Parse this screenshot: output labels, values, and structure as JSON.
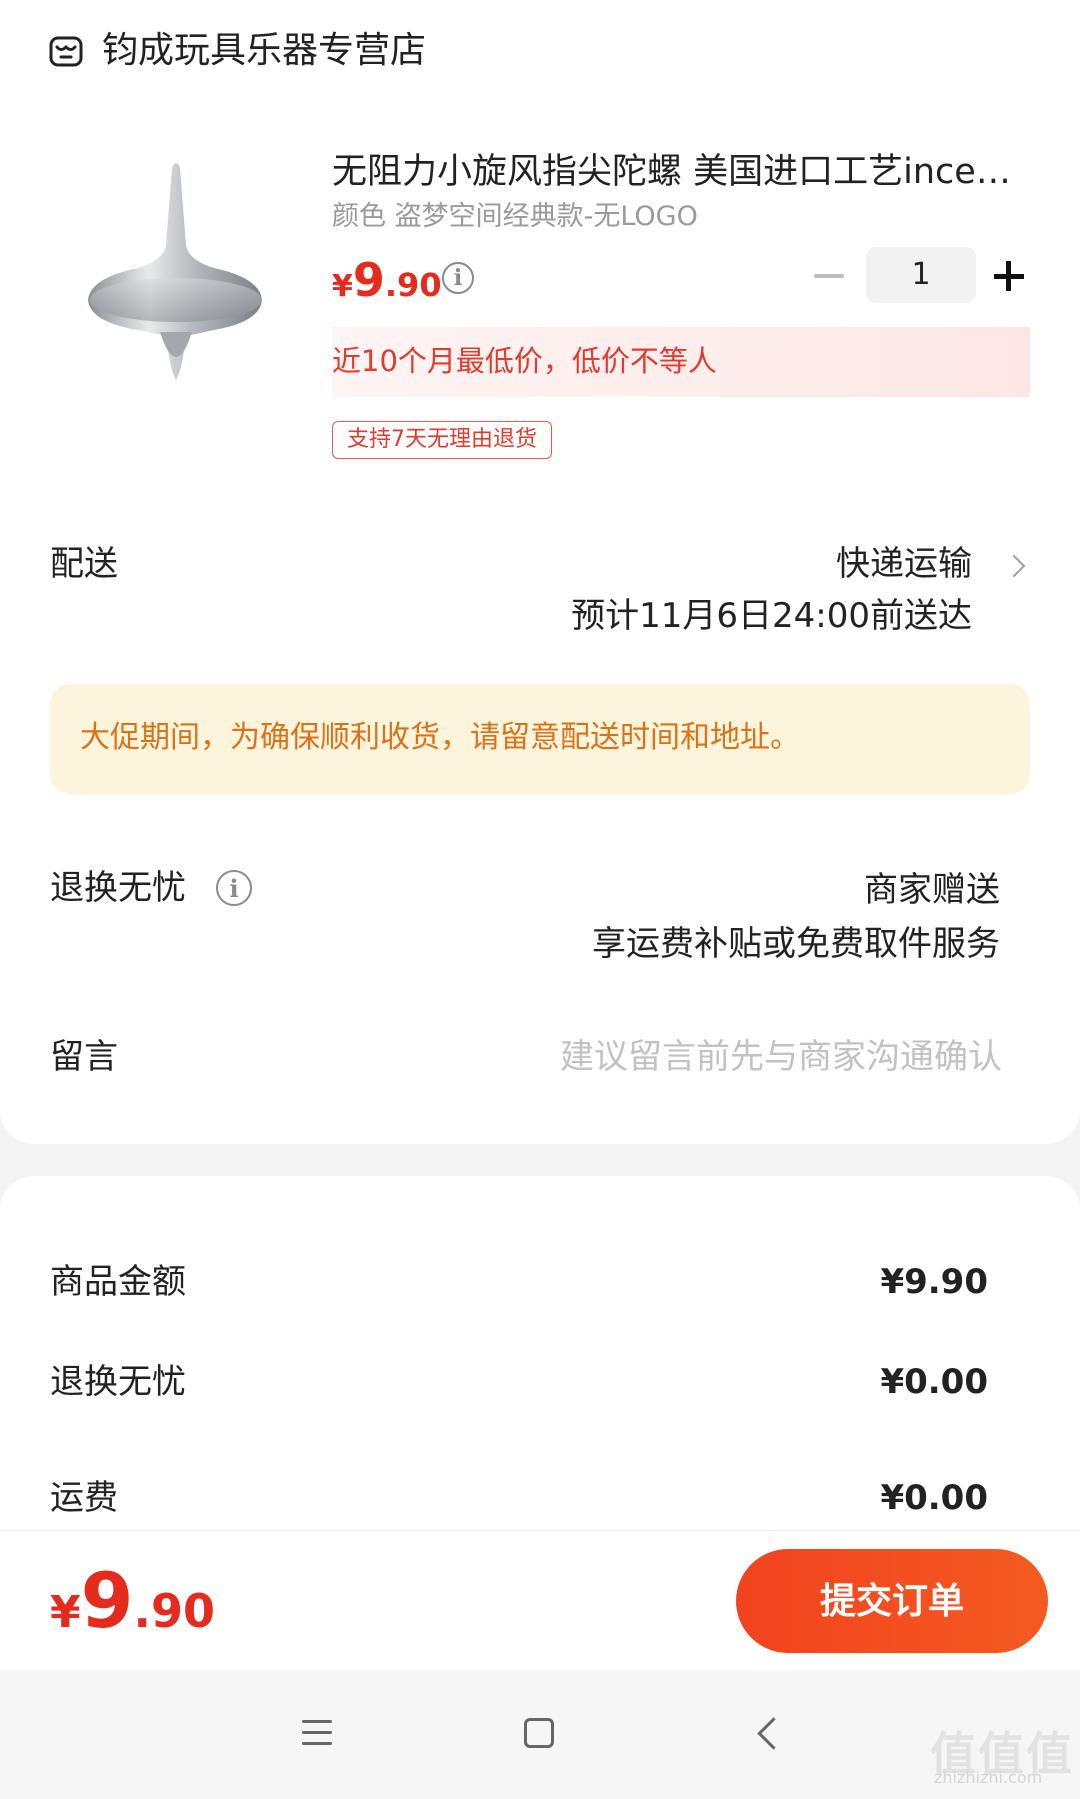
{
  "store": {
    "name": "钧成玩具乐器专营店",
    "icon": "store-icon"
  },
  "product": {
    "title": "无阻力小旋风指尖陀螺 美国进口工艺inception盗梦空间陀螺",
    "spec": "颜色 盗梦空间经典款-无LOGO",
    "price_symbol": "¥",
    "price_int": "9",
    "price_dec": ".90",
    "quantity": "1",
    "low_price_note": "近10个月最低价，低价不等人",
    "return_tag": "支持7天无理由退货",
    "thumbnail_icon": "spinning-top-image"
  },
  "delivery": {
    "label": "配送",
    "method": "快递运输",
    "eta": "预计11月6日24:00前送达",
    "notice": "大促期间，为确保顺利收货，请留意配送时间和地址。"
  },
  "worry_free": {
    "label": "退换无忧",
    "value_line1": "商家赠送",
    "value_line2": "享运费补贴或免费取件服务"
  },
  "message": {
    "label": "留言",
    "placeholder": "建议留言前先与商家沟通确认"
  },
  "costs": [
    {
      "label": "商品金额",
      "value": "¥9.90"
    },
    {
      "label": "退换无忧",
      "value": "¥0.00"
    },
    {
      "label": "运费",
      "value": "¥0.00"
    }
  ],
  "footer": {
    "total_symbol": "¥",
    "total_int": "9",
    "total_dec": ".90",
    "submit_label": "提交订单"
  },
  "watermark": {
    "text": "值值值",
    "sub": "zhizhizhi.com"
  },
  "colors": {
    "accent": "#e52a1e",
    "submit": "#f2421f",
    "notice_bg": "#fdf4dc",
    "notice_text": "#d9731a"
  }
}
